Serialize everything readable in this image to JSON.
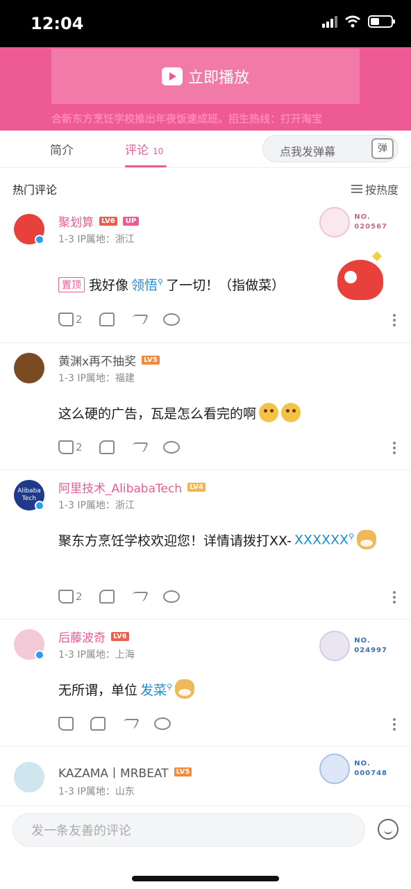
{
  "status": {
    "time": "12:04"
  },
  "player": {
    "play_label": "立即播放",
    "marquee": "合新东方烹饪学校推出年夜饭速成班。招生热线：打开淘宝"
  },
  "tabs": {
    "intro": "简介",
    "comments": "评论",
    "comments_count": "10",
    "danmaku_placeholder": "点我发弹幕",
    "danmaku_button": "弹"
  },
  "list_header": {
    "title": "热门评论",
    "sort_label": "按热度"
  },
  "comments": [
    {
      "username": "聚划算",
      "level": "LV6",
      "up_badge": "UP",
      "meta": "1-3  IP属地：浙江",
      "pinned_label": "置顶",
      "text_before": "我好像",
      "link": "领悟",
      "text_after": "了一切！（指做菜）",
      "likes": "2",
      "fan_no": "NO.",
      "fan_number": "020567"
    },
    {
      "username": "黄渊x再不抽奖",
      "level": "LV5",
      "meta": "1-3  IP属地：福建",
      "text": "这么硬的广告，瓦是怎么看完的啊",
      "likes": "2"
    },
    {
      "username": "阿里技术_AlibabaTech",
      "level": "LV4",
      "avatar_text": "Alibaba Tech",
      "meta": "1-3  IP属地：浙江",
      "text": "聚东方烹饪学校欢迎您！详情请拨打XX-",
      "link": "XXXXXX",
      "likes": "2"
    },
    {
      "username": "后藤波奇",
      "level": "LV6",
      "meta": "1-3  IP属地：上海",
      "text": "无所谓，单位",
      "link": "发菜",
      "fan_no": "NO.",
      "fan_number": "024997"
    },
    {
      "username": "KAZAMA丨MRBEAT",
      "level": "LV5",
      "meta": "1-3  IP属地：山东",
      "fan_no": "NO.",
      "fan_number": "000748"
    }
  ],
  "composer": {
    "placeholder": "发一条友善的评论"
  },
  "colors": {
    "accent": "#ee5a93",
    "link": "#1d8ed6",
    "lv6": "#e8604c",
    "lv5": "#f08a3c",
    "lv4": "#f5b348"
  }
}
